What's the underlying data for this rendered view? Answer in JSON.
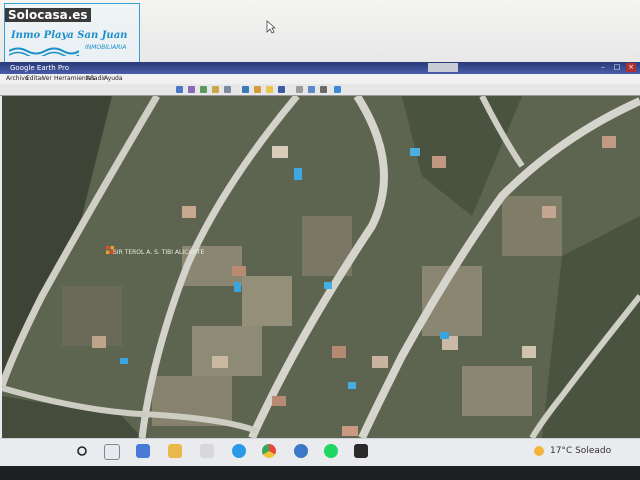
{
  "watermark": {
    "site": "Solocasa.es",
    "agency_name": "Inmo Playa San Juan",
    "agency_sub": "INMOBILIARIA"
  },
  "window": {
    "title": "Google Earth Pro"
  },
  "menu": {
    "items": [
      "Archivo",
      "Editar",
      "Ver",
      "Herramientas",
      "Añadir",
      "Ayuda"
    ]
  },
  "map": {
    "place_label": "SIR TEROL A. S. TIBI ALICANTE"
  },
  "taskbar": {
    "weather": "17°C  Soleado",
    "icons": [
      "search-icon",
      "task-view-icon",
      "file-explorer-icon",
      "mail-icon",
      "folder-icon",
      "store-icon",
      "edge-icon",
      "chrome-icon",
      "google-earth-icon",
      "spotify-icon",
      "epic-icon"
    ]
  },
  "colors": {
    "titlebar": "#2a3a78",
    "accent": "#1d8fcb"
  }
}
